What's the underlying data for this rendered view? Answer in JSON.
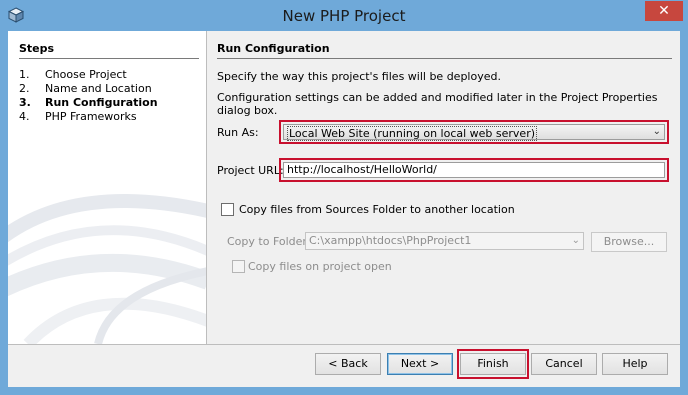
{
  "window": {
    "title": "New PHP Project",
    "close_glyph": "✕",
    "icon": "netbeans-cube-icon"
  },
  "steps": {
    "title": "Steps",
    "items": [
      {
        "num": "1.",
        "label": "Choose Project",
        "active": false
      },
      {
        "num": "2.",
        "label": "Name and Location",
        "active": false
      },
      {
        "num": "3.",
        "label": "Run Configuration",
        "active": true
      },
      {
        "num": "4.",
        "label": "PHP Frameworks",
        "active": false
      }
    ]
  },
  "main": {
    "title": "Run Configuration",
    "description_1": "Specify the way this project's files will be deployed.",
    "description_2": "Configuration settings can be added and modified later in the Project Properties dialog box.",
    "run_as_label": "Run As:",
    "run_as_value": "Local Web Site (running on local web server)",
    "project_url_label": "Project URL:",
    "project_url_value": "http://localhost/HelloWorld/",
    "copy_files_label": "Copy files from Sources Folder to another location",
    "copy_to_folder_label": "Copy to Folder:",
    "copy_to_folder_value": "C:\\xampp\\htdocs\\PhpProject1",
    "browse_label": "Browse...",
    "copy_on_open_label": "Copy files on project open"
  },
  "buttons": {
    "back": "< Back",
    "next": "Next >",
    "finish": "Finish",
    "cancel": "Cancel",
    "help": "Help"
  },
  "highlight_color": "#c8102e",
  "titlebar_color": "#6fa9d9"
}
